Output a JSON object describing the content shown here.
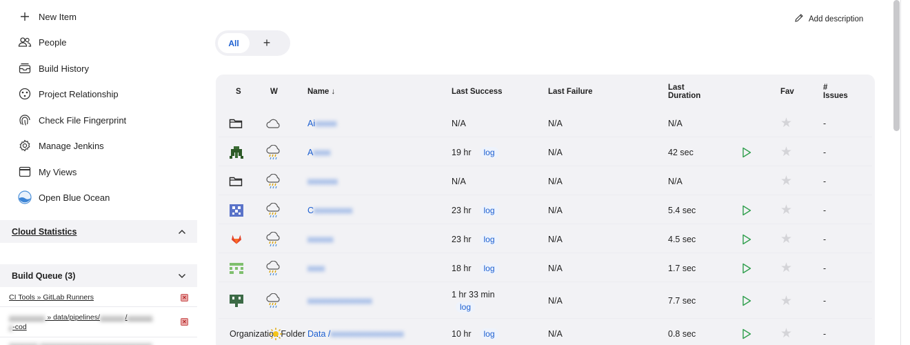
{
  "sidebar": {
    "items": [
      {
        "label": "New Item",
        "icon": "plus-icon"
      },
      {
        "label": "People",
        "icon": "people-icon"
      },
      {
        "label": "Build History",
        "icon": "build-history-icon"
      },
      {
        "label": "Project Relationship",
        "icon": "relationship-icon"
      },
      {
        "label": "Check File Fingerprint",
        "icon": "fingerprint-icon"
      },
      {
        "label": "Manage Jenkins",
        "icon": "gear-icon"
      },
      {
        "label": "My Views",
        "icon": "window-icon"
      },
      {
        "label": "Open Blue Ocean",
        "icon": "blue-ocean-icon"
      }
    ],
    "cloud_statistics": {
      "title": "Cloud Statistics"
    },
    "build_queue": {
      "title": "Build Queue (3)",
      "items": [
        {
          "text": "CI Tools » GitLab Runners"
        },
        {
          "text_visible": "» data/pipelines/",
          "text_tail": "/",
          "text_end": "-cod"
        }
      ]
    }
  },
  "header": {
    "add_description": "Add description"
  },
  "tabs": {
    "all": "All",
    "add": "+"
  },
  "table": {
    "headers": {
      "s": "S",
      "w": "W",
      "name": "Name ↓",
      "last_success": "Last Success",
      "last_failure": "Last Failure",
      "last_duration_1": "Last",
      "last_duration_2": "Duration",
      "fav": "Fav",
      "issues_1": "#",
      "issues_2": "Issues"
    },
    "log_label": "log",
    "rows": [
      {
        "status_icon": "folder-icon",
        "weather_icon": "cloudy-icon",
        "name": "Ai",
        "last_success": "N/A",
        "has_log": false,
        "last_failure": "N/A",
        "duration": "N/A",
        "runnable": false,
        "issues": "-"
      },
      {
        "status_icon": "project-avatar-icon",
        "weather_icon": "storm-icon",
        "name": "A",
        "last_success": "19 hr",
        "has_log": true,
        "last_failure": "N/A",
        "duration": "42 sec",
        "runnable": true,
        "issues": "-"
      },
      {
        "status_icon": "folder-icon",
        "weather_icon": "storm-icon",
        "name": "",
        "last_success": "N/A",
        "has_log": false,
        "last_failure": "N/A",
        "duration": "N/A",
        "runnable": false,
        "issues": "-"
      },
      {
        "status_icon": "project-avatar-icon",
        "weather_icon": "storm-icon",
        "name": "C",
        "last_success": "23 hr",
        "has_log": true,
        "last_failure": "N/A",
        "duration": "5.4 sec",
        "runnable": true,
        "issues": "-"
      },
      {
        "status_icon": "gitlab-icon",
        "weather_icon": "storm-icon",
        "name": "",
        "last_success": "23 hr",
        "has_log": true,
        "last_failure": "N/A",
        "duration": "4.5 sec",
        "runnable": true,
        "issues": "-"
      },
      {
        "status_icon": "project-avatar-icon",
        "weather_icon": "storm-icon",
        "name": "",
        "last_success": "18 hr",
        "has_log": true,
        "last_failure": "N/A",
        "duration": "1.7 sec",
        "runnable": true,
        "issues": "-"
      },
      {
        "status_icon": "project-avatar-icon",
        "weather_icon": "storm-icon",
        "name": "",
        "last_success": "1 hr 33 min",
        "has_log": true,
        "last_failure": "N/A",
        "duration": "7.7 sec",
        "runnable": true,
        "issues": "-"
      },
      {
        "status_text": "Organization Folder",
        "weather_icon": "sunny-icon",
        "name": "Data / ",
        "last_success": "10 hr",
        "has_log": true,
        "last_failure": "N/A",
        "duration": "0.8 sec",
        "runnable": true,
        "issues": "-"
      }
    ]
  },
  "colors": {
    "accent": "#1c5fd1",
    "play": "#2e9e4b",
    "panel": "#f2f2f5"
  }
}
